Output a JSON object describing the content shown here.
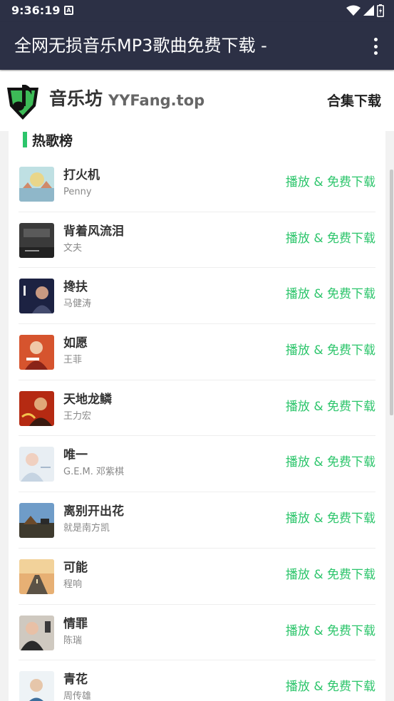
{
  "status_bar": {
    "time": "9:36:19",
    "app_badge": "A"
  },
  "app_bar": {
    "title": "全网无损音乐MP3歌曲免费下载 -"
  },
  "site_header": {
    "brand_cn": "音乐坊",
    "brand_en": "YYFang.top",
    "collection_link": "合集下载"
  },
  "section": {
    "title": "热歌榜"
  },
  "songs": [
    {
      "title": "打火机",
      "artist": "Penny",
      "action": "播放 & 免费下载"
    },
    {
      "title": "背着风流泪",
      "artist": "文夫",
      "action": "播放 & 免费下载"
    },
    {
      "title": "搀扶",
      "artist": "马健涛",
      "action": "播放 & 免费下载"
    },
    {
      "title": "如愿",
      "artist": "王菲",
      "action": "播放 & 免费下载"
    },
    {
      "title": "天地龙鳞",
      "artist": "王力宏",
      "action": "播放 & 免费下载"
    },
    {
      "title": "唯一",
      "artist": "G.E.M. 邓紫棋",
      "action": "播放 & 免费下载"
    },
    {
      "title": "离别开出花",
      "artist": "就是南方凯",
      "action": "播放 & 免费下载"
    },
    {
      "title": "可能",
      "artist": "程响",
      "action": "播放 & 免费下载"
    },
    {
      "title": "情罪",
      "artist": "陈瑞",
      "action": "播放 & 免费下载"
    },
    {
      "title": "青花",
      "artist": "周传雄",
      "action": "播放 & 免费下载"
    }
  ],
  "colors": {
    "bar_background": "#2c3045",
    "accent_green": "#2cc56b"
  }
}
